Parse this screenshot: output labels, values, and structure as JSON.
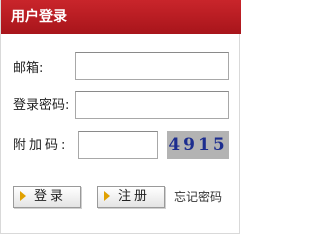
{
  "header": {
    "title": "用户登录"
  },
  "form": {
    "email_label": "邮箱:",
    "email_value": "",
    "password_label": "登录密码:",
    "password_value": "",
    "captcha_label": "附加码:",
    "captcha_value": "",
    "captcha_code": "4915"
  },
  "actions": {
    "login_label": "登录",
    "register_label": "注册",
    "forgot_label": "忘记密码"
  },
  "colors": {
    "header_bg": "#b71c22",
    "captcha_bg": "#b3b3b3",
    "captcha_text": "#1c2d8f",
    "button_arrow": "#e0a000"
  }
}
